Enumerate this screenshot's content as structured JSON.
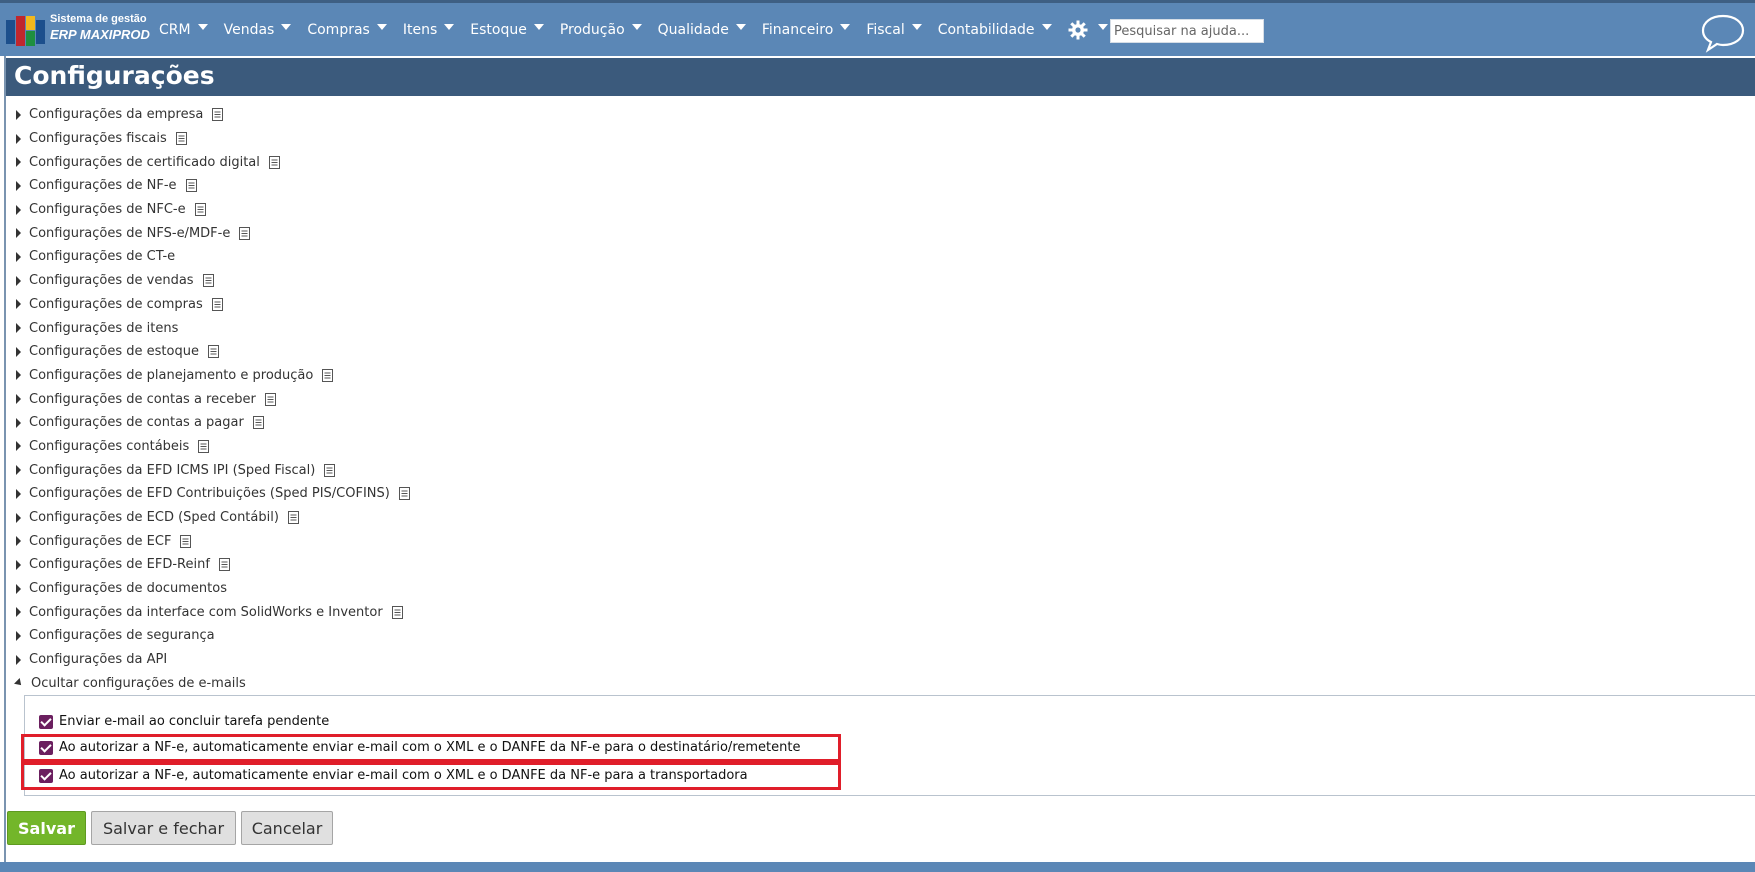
{
  "app": {
    "logo_line1": "Sistema de gestão",
    "logo_line2": "ERP MAXIPROD",
    "brand_color": "#5b87b6"
  },
  "nav": {
    "items": [
      {
        "label": "CRM"
      },
      {
        "label": "Vendas"
      },
      {
        "label": "Compras"
      },
      {
        "label": "Itens"
      },
      {
        "label": "Estoque"
      },
      {
        "label": "Produção"
      },
      {
        "label": "Qualidade"
      },
      {
        "label": "Financeiro"
      },
      {
        "label": "Fiscal"
      },
      {
        "label": "Contabilidade"
      }
    ],
    "settings_icon": "gear-icon",
    "help_icon": "help-icon",
    "search_placeholder": "Pesquisar na ajuda...",
    "chat_icon": "chat-bubble-icon"
  },
  "page": {
    "title": "Configurações",
    "title_bar_color": "#3b5a7c"
  },
  "sections": [
    {
      "label": "Configurações da empresa",
      "has_doc": true
    },
    {
      "label": "Configurações fiscais",
      "has_doc": true
    },
    {
      "label": "Configurações de certificado digital",
      "has_doc": true
    },
    {
      "label": "Configurações de NF-e",
      "has_doc": true
    },
    {
      "label": "Configurações de NFC-e",
      "has_doc": true
    },
    {
      "label": "Configurações de NFS-e/MDF-e",
      "has_doc": true
    },
    {
      "label": "Configurações de CT-e",
      "has_doc": false
    },
    {
      "label": "Configurações de vendas",
      "has_doc": true
    },
    {
      "label": "Configurações de compras",
      "has_doc": true
    },
    {
      "label": "Configurações de itens",
      "has_doc": false
    },
    {
      "label": "Configurações de estoque",
      "has_doc": true
    },
    {
      "label": "Configurações de planejamento e produção",
      "has_doc": true
    },
    {
      "label": "Configurações de contas a receber",
      "has_doc": true
    },
    {
      "label": "Configurações de contas a pagar",
      "has_doc": true
    },
    {
      "label": "Configurações contábeis",
      "has_doc": true
    },
    {
      "label": "Configurações da EFD ICMS IPI (Sped Fiscal)",
      "has_doc": true
    },
    {
      "label": "Configurações de EFD Contribuições (Sped PIS/COFINS)",
      "has_doc": true
    },
    {
      "label": "Configurações de ECD (Sped Contábil)",
      "has_doc": true
    },
    {
      "label": "Configurações de ECF",
      "has_doc": true
    },
    {
      "label": "Configurações de EFD-Reinf",
      "has_doc": true
    },
    {
      "label": "Configurações de documentos",
      "has_doc": false
    },
    {
      "label": "Configurações da interface com SolidWorks e Inventor",
      "has_doc": true
    },
    {
      "label": "Configurações de segurança",
      "has_doc": false
    },
    {
      "label": "Configurações da API",
      "has_doc": false
    }
  ],
  "email_section": {
    "toggle_label": "Ocultar configurações de e-mails",
    "options": [
      {
        "label": "Enviar e-mail ao concluir tarefa pendente",
        "checked": true,
        "highlighted": false
      },
      {
        "label": "Ao autorizar a NF-e, automaticamente enviar e-mail com o XML e o DANFE da NF-e para o destinatário/remetente",
        "checked": true,
        "highlighted": true
      },
      {
        "label": "Ao autorizar a NF-e, automaticamente enviar e-mail com o XML e o DANFE da NF-e para a transportadora",
        "checked": true,
        "highlighted": true
      }
    ],
    "checkbox_color": "#6b1f5f",
    "highlight_color": "#e01e2a"
  },
  "actions": {
    "save": "Salvar",
    "save_close": "Salvar e fechar",
    "cancel": "Cancelar",
    "save_color": "#73b62a"
  }
}
